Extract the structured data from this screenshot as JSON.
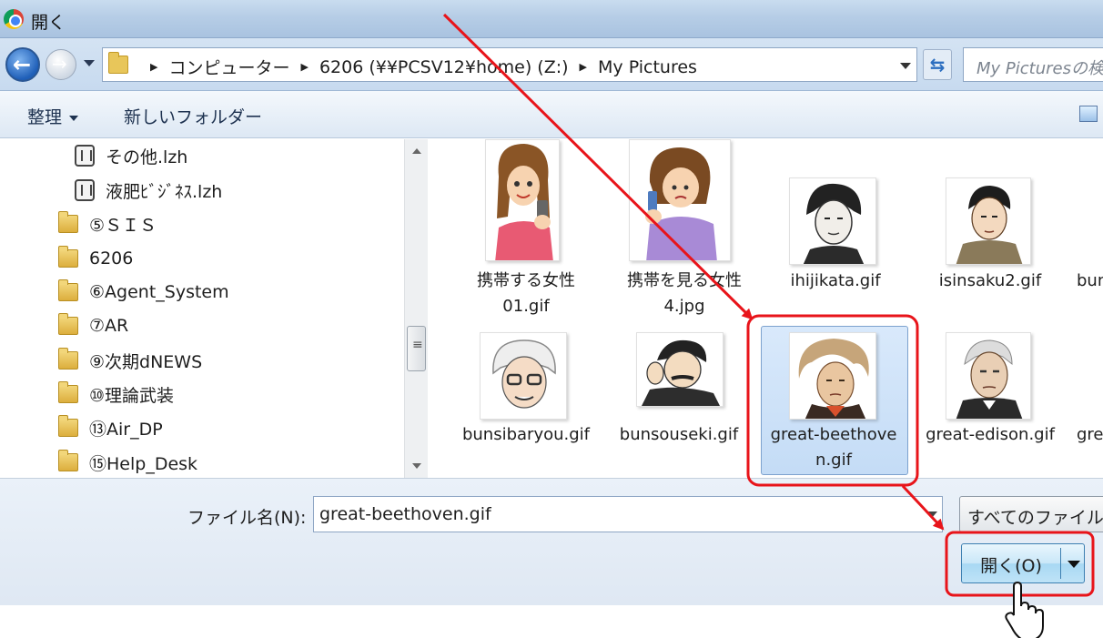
{
  "window": {
    "title": "開く",
    "app_icon": "chrome-icon"
  },
  "address": {
    "crumbs": [
      "コンピューター",
      "6206 (¥¥PCSV12¥home) (Z:)",
      "My Pictures"
    ],
    "search_placeholder": "My Picturesの検索"
  },
  "toolbar": {
    "organize_label": "整理",
    "new_folder_label": "新しいフォルダー"
  },
  "nav_tree": {
    "items": [
      {
        "label": "その他.lzh",
        "icon": "archive-icon"
      },
      {
        "label": "液肥ﾋﾞｼﾞﾈｽ.lzh",
        "icon": "archive-icon"
      },
      {
        "label": "⑤ＳＩＳ",
        "icon": "folder-icon"
      },
      {
        "label": "6206",
        "icon": "folder-icon"
      },
      {
        "label": "⑥Agent_System",
        "icon": "folder-icon"
      },
      {
        "label": "⑦AR",
        "icon": "folder-icon"
      },
      {
        "label": "⑨次期dNEWS",
        "icon": "folder-icon"
      },
      {
        "label": "⑩理論武装",
        "icon": "folder-icon"
      },
      {
        "label": "⑬Air_DP",
        "icon": "folder-icon"
      },
      {
        "label": "⑮Help_Desk",
        "icon": "folder-icon"
      }
    ]
  },
  "files": [
    {
      "line1": "携帯する女性",
      "line2": "01.gif"
    },
    {
      "line1": "携帯を見る女性",
      "line2": "4.jpg"
    },
    {
      "line1": "ihijikata.gif",
      "line2": ""
    },
    {
      "line1": "isinsaku2.gif",
      "line2": ""
    },
    {
      "line1": "bun",
      "line2": ""
    },
    {
      "line1": "bunsibaryou.gif",
      "line2": ""
    },
    {
      "line1": "bunsouseki.gif",
      "line2": ""
    },
    {
      "line1": "great-beethove",
      "line2": "n.gif",
      "selected": true
    },
    {
      "line1": "great-edison.gif",
      "line2": ""
    },
    {
      "line1": "gre",
      "line2": ""
    }
  ],
  "bottom": {
    "filename_label": "ファイル名(N):",
    "filename_value": "great-beethoven.gif",
    "filetype_value": "すべてのファイル",
    "open_button_label": "開く(O)"
  },
  "annotation_color": "#e8141a",
  "selection_color": "#c4dcf6"
}
